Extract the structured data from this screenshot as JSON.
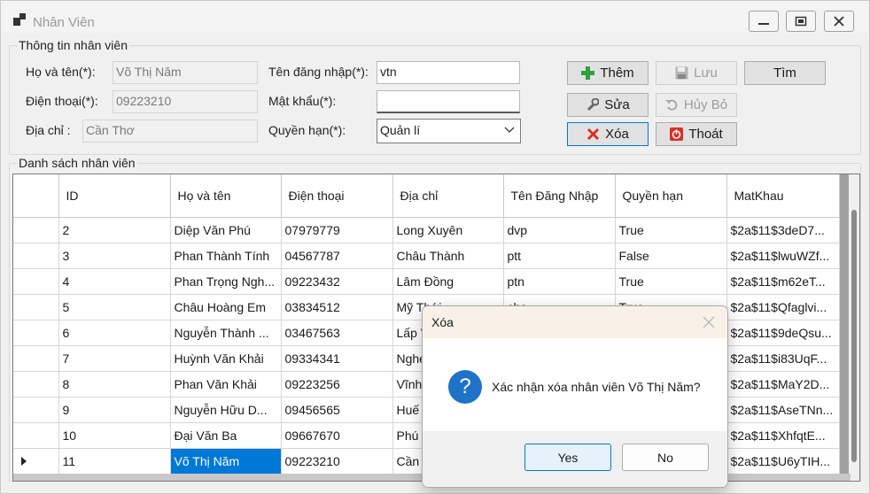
{
  "window": {
    "title": "Nhân Viên"
  },
  "info_group": {
    "label": "Thông tin nhân viên"
  },
  "fields": {
    "name_label": "Họ và tên(*):",
    "name_value": "Võ Thị Năm",
    "phone_label": "Điện thoại(*):",
    "phone_value": "09223210",
    "address_label": "Địa chỉ :",
    "address_value": "Cần Thơ",
    "username_label": "Tên đăng nhập(*):",
    "username_value": "vtn",
    "password_label": "Mật khẩu(*):",
    "password_value": "",
    "role_label": "Quyền hạn(*):",
    "role_value": "Quản lí"
  },
  "buttons": {
    "add": "Thêm",
    "save": "Lưu",
    "search": "Tìm",
    "edit": "Sửa",
    "cancel": "Hủy Bỏ",
    "delete": "Xóa",
    "exit": "Thoát"
  },
  "list_group": {
    "label": "Danh sách nhân viên"
  },
  "table": {
    "columns": [
      "ID",
      "Họ và tên",
      "Điện thoại",
      "Địa chỉ",
      "Tên Đăng Nhập",
      "Quyền hạn",
      "MatKhau"
    ],
    "rows": [
      [
        "2",
        "Diệp Văn Phú",
        "07979779",
        "Long Xuyên",
        "dvp",
        "True",
        "$2a$11$3deD7..."
      ],
      [
        "3",
        "Phan Thành Tính",
        "04567787",
        "Châu Thành",
        "ptt",
        "False",
        "$2a$11$lwuWZf..."
      ],
      [
        "4",
        "Phan Trọng Ngh...",
        "09223432",
        "Lâm Đồng",
        "ptn",
        "True",
        "$2a$11$m62eT..."
      ],
      [
        "5",
        "Châu Hoàng Em",
        "03834512",
        "Mỹ Thới",
        "che",
        "True",
        "$2a$11$Qfaglvi..."
      ],
      [
        "6",
        "Nguyễn Thành ...",
        "03467563",
        "Lấp Vò",
        "",
        "",
        "$2a$11$9deQsu..."
      ],
      [
        "7",
        "Huỳnh Văn Khải",
        "09334341",
        "Nghe",
        "",
        "",
        "$2a$11$i83UqF..."
      ],
      [
        "8",
        "Phan Văn Khải",
        "09223256",
        "Vĩnh",
        "",
        "",
        "$2a$11$MaY2D..."
      ],
      [
        "9",
        "Nguyễn Hữu D...",
        "09456565",
        "Huế",
        "",
        "",
        "$2a$11$AseTNn..."
      ],
      [
        "10",
        "Đại Văn Ba",
        "09667670",
        "Phú",
        "",
        "",
        "$2a$11$XhfqtE..."
      ],
      [
        "11",
        "Võ Thị Năm",
        "09223210",
        "Cần",
        "",
        "",
        "$2a$11$U6yTIH..."
      ]
    ],
    "selected_row_index": 9
  },
  "dialog": {
    "title": "Xóa",
    "message": "Xác nhận xóa nhân viên Võ Thị Năm?",
    "yes": "Yes",
    "no": "No"
  }
}
